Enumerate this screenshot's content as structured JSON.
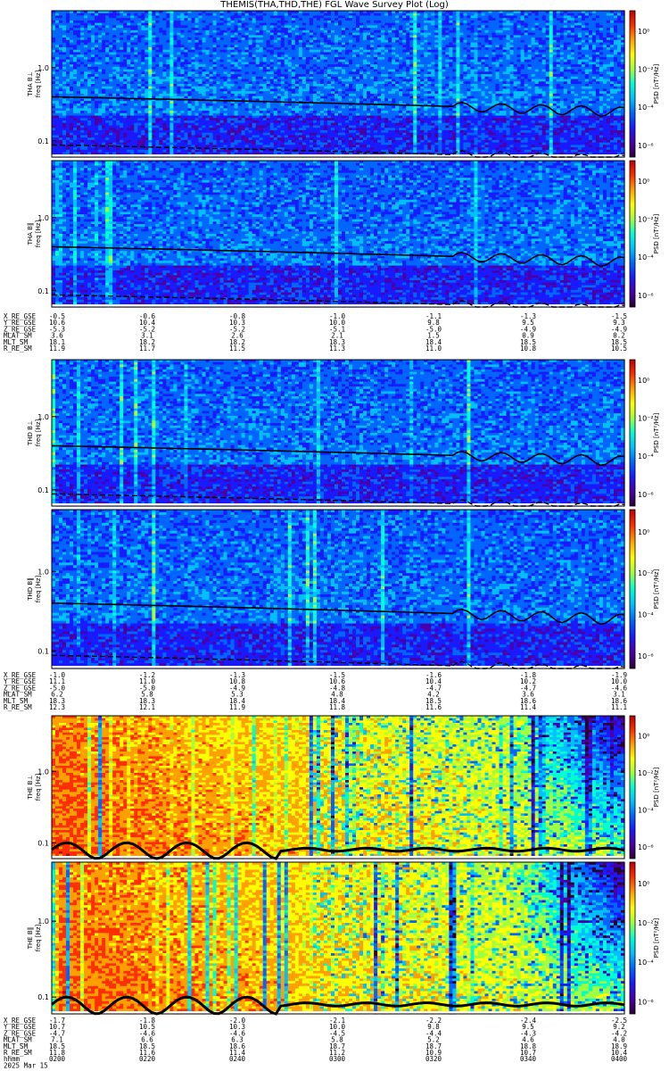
{
  "title": "THEMIS(THA,THD,THE) FGL Wave Survey Plot (Log)",
  "colors": {
    "colormap": [
      "#2b0033",
      "#4a00a8",
      "#1a1aff",
      "#0066ff",
      "#00c0ff",
      "#00ffd0",
      "#a0ff40",
      "#ffff00",
      "#ffa000",
      "#ff3000",
      "#c00000"
    ]
  },
  "chart_data": [
    {
      "type": "heatmap",
      "probe": "THA",
      "ylabel": "THA B⊥",
      "yunit": "freq [Hz]",
      "yticks": [
        "0.1",
        "1.0"
      ],
      "yscale": "log",
      "ylim": [
        0.06,
        6
      ],
      "zlabel": "PSD [nT²/Hz]",
      "zticks": [
        "10⁰",
        "10⁻²",
        "10⁻⁴",
        "10⁻⁶"
      ],
      "intensity": "low"
    },
    {
      "type": "heatmap",
      "probe": "THA",
      "ylabel": "THA B‖",
      "yunit": "freq [Hz]",
      "yticks": [
        "0.1",
        "1.0"
      ],
      "yscale": "log",
      "ylim": [
        0.06,
        6
      ],
      "zlabel": "PSD [nT²/Hz]",
      "zticks": [
        "10⁰",
        "10⁻²",
        "10⁻⁴",
        "10⁻⁶"
      ],
      "intensity": "low"
    },
    {
      "type": "heatmap",
      "probe": "THD",
      "ylabel": "THD B⊥",
      "yunit": "freq [Hz]",
      "yticks": [
        "0.1",
        "1.0"
      ],
      "yscale": "log",
      "ylim": [
        0.06,
        6
      ],
      "zlabel": "PSD [nT²/Hz]",
      "zticks": [
        "10⁰",
        "10⁻²",
        "10⁻⁴",
        "10⁻⁶"
      ],
      "intensity": "low"
    },
    {
      "type": "heatmap",
      "probe": "THD",
      "ylabel": "THD B‖",
      "yunit": "freq [Hz]",
      "yticks": [
        "0.1",
        "1.0"
      ],
      "yscale": "log",
      "ylim": [
        0.06,
        6
      ],
      "zlabel": "PSD [nT²/Hz]",
      "zticks": [
        "10⁰",
        "10⁻²",
        "10⁻⁴",
        "10⁻⁶"
      ],
      "intensity": "low"
    },
    {
      "type": "heatmap",
      "probe": "THE",
      "ylabel": "THE B⊥",
      "yunit": "freq [Hz]",
      "yticks": [
        "0.1",
        "1.0"
      ],
      "yscale": "log",
      "ylim": [
        0.06,
        6
      ],
      "zlabel": "PSD [nT²/Hz]",
      "zticks": [
        "10⁰",
        "10⁻²",
        "10⁻⁴",
        "10⁻⁶"
      ],
      "intensity": "high"
    },
    {
      "type": "heatmap",
      "probe": "THE",
      "ylabel": "THE B‖",
      "yunit": "freq [Hz]",
      "yticks": [
        "0.1",
        "1.0"
      ],
      "yscale": "log",
      "ylim": [
        0.06,
        6
      ],
      "zlabel": "PSD [nT²/Hz]",
      "zticks": [
        "10⁰",
        "10⁻²",
        "10⁻⁴",
        "10⁻⁶"
      ],
      "intensity": "high"
    }
  ],
  "ephemeris": [
    {
      "probe": "THA",
      "rows": [
        {
          "label": "X_RE_GSE",
          "values": [
            "-0.5",
            "-0.6",
            "-0.8",
            "-1.0",
            "-1.1",
            "-1.3",
            "-1.5"
          ]
        },
        {
          "label": "Y_RE_GSE",
          "values": [
            "10.6",
            "10.4",
            "10.3",
            "10.0",
            "9.8",
            "9.5",
            "9.3"
          ]
        },
        {
          "label": "Z_RE_GSE",
          "values": [
            "-5.3",
            "-5.2",
            "-5.2",
            "-5.1",
            "-5.0",
            "-4.9",
            "-4.9"
          ]
        },
        {
          "label": "MLAT_SM",
          "values": [
            "3.6",
            "3.1",
            "2.6",
            "2.1",
            "1.5",
            "0.9",
            "0.2"
          ]
        },
        {
          "label": "MLT_SM",
          "values": [
            "18.1",
            "18.2",
            "18.2",
            "18.3",
            "18.4",
            "18.5",
            "18.5"
          ]
        },
        {
          "label": "R_RE_SM",
          "values": [
            "11.9",
            "11.7",
            "11.5",
            "11.3",
            "11.0",
            "10.8",
            "10.5"
          ]
        }
      ]
    },
    {
      "probe": "THD",
      "rows": [
        {
          "label": "X_RE_GSE",
          "values": [
            "-1.0",
            "-1.2",
            "-1.3",
            "-1.5",
            "-1.6",
            "-1.8",
            "-1.9"
          ]
        },
        {
          "label": "Y_RE_GSE",
          "values": [
            "11.1",
            "11.0",
            "10.8",
            "10.6",
            "10.4",
            "10.2",
            "10.0"
          ]
        },
        {
          "label": "Z_RE_GSE",
          "values": [
            "-5.0",
            "-5.0",
            "-4.9",
            "-4.8",
            "-4.7",
            "-4.7",
            "-4.6"
          ]
        },
        {
          "label": "MLAT_SM",
          "values": [
            "6.2",
            "5.8",
            "5.3",
            "4.8",
            "4.2",
            "3.6",
            "3.1"
          ]
        },
        {
          "label": "MLT_SM",
          "values": [
            "18.3",
            "18.3",
            "18.4",
            "18.4",
            "18.5",
            "18.6",
            "18.6"
          ]
        },
        {
          "label": "R_RE_SM",
          "values": [
            "12.3",
            "12.1",
            "11.9",
            "11.8",
            "11.6",
            "11.4",
            "11.1"
          ]
        }
      ]
    },
    {
      "probe": "THE",
      "rows": [
        {
          "label": "X_RE_GSE",
          "values": [
            "-1.7",
            "-1.8",
            "-2.0",
            "-2.1",
            "-2.2",
            "-2.4",
            "-2.5"
          ]
        },
        {
          "label": "Y_RE_GSE",
          "values": [
            "10.7",
            "10.5",
            "10.3",
            "10.0",
            "9.8",
            "9.5",
            "9.2"
          ]
        },
        {
          "label": "Z_RE_GSE",
          "values": [
            "-4.7",
            "-4.6",
            "-4.6",
            "-4.5",
            "-4.4",
            "-4.3",
            "-4.2"
          ]
        },
        {
          "label": "MLAT_SM",
          "values": [
            "7.1",
            "6.6",
            "6.3",
            "5.8",
            "5.2",
            "4.6",
            "4.0"
          ]
        },
        {
          "label": "MLT_SM",
          "values": [
            "18.5",
            "18.5",
            "18.6",
            "18.7",
            "18.7",
            "18.8",
            "18.9"
          ]
        },
        {
          "label": "R_RE_SM",
          "values": [
            "11.8",
            "11.6",
            "11.4",
            "11.2",
            "10.9",
            "10.7",
            "10.4"
          ]
        },
        {
          "label": "hhmm",
          "values": [
            "0200",
            "0220",
            "0240",
            "0300",
            "0320",
            "0340",
            "0400"
          ]
        },
        {
          "label": "2025 Mar 15",
          "values": []
        }
      ]
    }
  ]
}
